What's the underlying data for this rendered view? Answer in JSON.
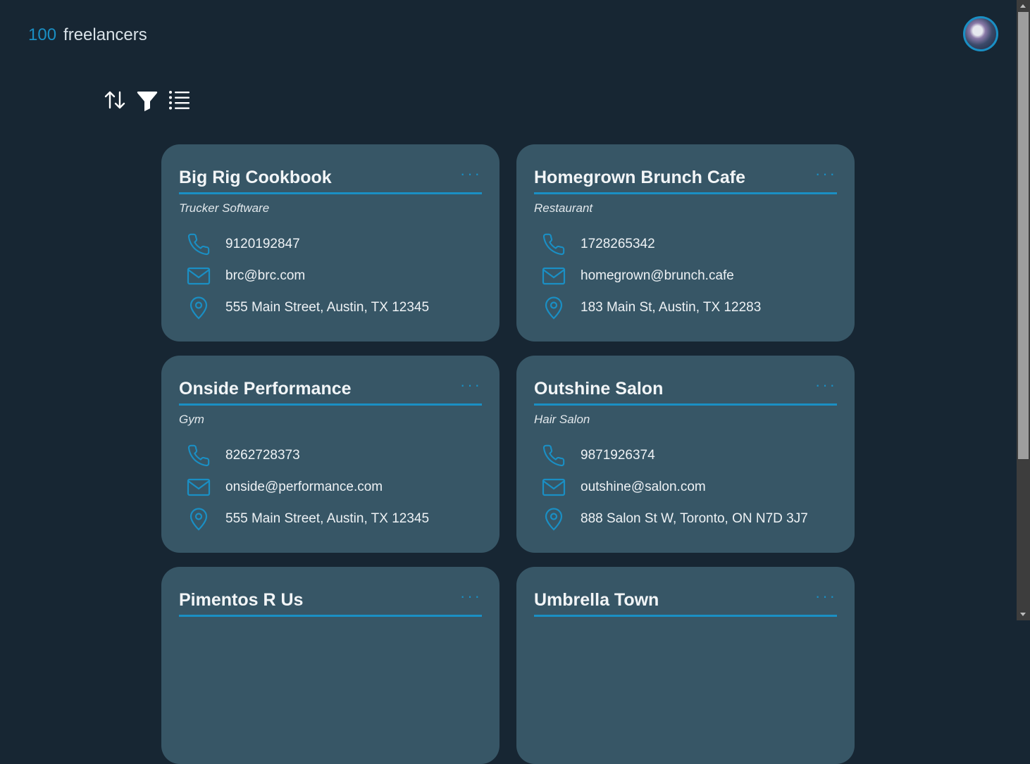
{
  "header": {
    "count": "100",
    "label": "freelancers"
  },
  "toolbar": {
    "sort_icon": "sort-icon",
    "filter_icon": "filter-icon",
    "list_icon": "list-icon"
  },
  "colors": {
    "background": "#172633",
    "card": "#375666",
    "accent": "#1a8fc4"
  },
  "cards": [
    {
      "title": "Big Rig Cookbook",
      "type": "Trucker Software",
      "phone": "9120192847",
      "email": "brc@brc.com",
      "address": "555 Main Street, Austin, TX 12345"
    },
    {
      "title": "Homegrown Brunch Cafe",
      "type": "Restaurant",
      "phone": "1728265342",
      "email": "homegrown@brunch.cafe",
      "address": "183 Main St, Austin, TX 12283"
    },
    {
      "title": "Onside Performance",
      "type": "Gym",
      "phone": "8262728373",
      "email": "onside@performance.com",
      "address": "555 Main Street, Austin, TX 12345"
    },
    {
      "title": "Outshine Salon",
      "type": "Hair Salon",
      "phone": "9871926374",
      "email": "outshine@salon.com",
      "address": "888 Salon St W, Toronto, ON N7D 3J7"
    },
    {
      "title": "Pimentos R Us",
      "type": "",
      "phone": "",
      "email": "",
      "address": ""
    },
    {
      "title": "Umbrella Town",
      "type": "",
      "phone": "",
      "email": "",
      "address": ""
    }
  ],
  "more_label": "···"
}
